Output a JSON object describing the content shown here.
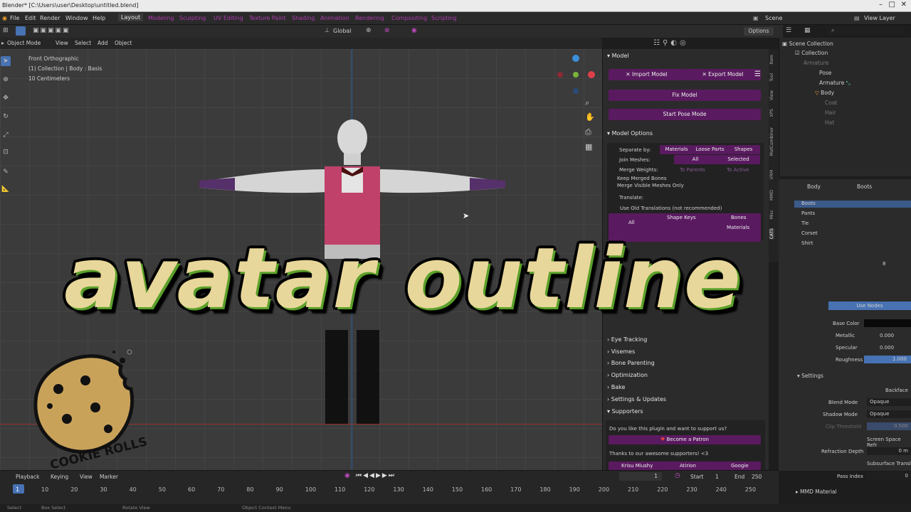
{
  "window_title": "Blender* [C:\\Users\\user\\Desktop\\untitled.blend]",
  "menu": [
    "File",
    "Edit",
    "Render",
    "Window",
    "Help"
  ],
  "workspaces": [
    "Layout",
    "Modeling",
    "Sculpting",
    "UV Editing",
    "Texture Paint",
    "Shading",
    "Animation",
    "Rendering",
    "Compositing",
    "Scripting"
  ],
  "scene_label": "Scene",
  "view_layer_label": "View Layer",
  "header3": {
    "mode": "Object Mode",
    "view": "View",
    "select": "Select",
    "add": "Add",
    "object": "Object",
    "orientation": "Global",
    "options": "Options"
  },
  "viewport_info": [
    "Front Orthographic",
    "(1) Collection | Body : Basis",
    "10 Centimeters"
  ],
  "cats": {
    "model_title": "Model",
    "import_model": "Import Model",
    "export_model": "Export Model",
    "fix_model": "Fix Model",
    "start_pose_mode": "Start Pose Mode",
    "model_options_title": "Model Options",
    "separate_by": "Separate by:",
    "materials": "Materials",
    "loose_parts": "Loose Parts",
    "shapes": "Shapes",
    "join_meshes": "Join Meshes:",
    "all": "All",
    "selected": "Selected",
    "merge_weights": "Merge Weights:",
    "to_parents": "To Parents",
    "to_active": "To Active",
    "keep_merged_bones": "Keep Merged Bones",
    "merge_visible": "Merge Visible Meshes Only",
    "translate": "Translate:",
    "use_old_translations": "Use Old Translations (not recommended)",
    "shape_keys": "Shape Keys",
    "bones": "Bones",
    "all2": "All",
    "materials2": "Materials",
    "sections": [
      "Eye Tracking",
      "Visemes",
      "Bone Parenting",
      "Optimization",
      "Bake",
      "Settings & Updates"
    ],
    "supporters_title": "Supporters",
    "support_question": "Do you like this plugin and want to support us?",
    "become_patron": "Become a Patron",
    "thanks": "Thanks to our awesome supporters! <3",
    "supporters": [
      "Krisu Miushy",
      "Atirion",
      "Googie"
    ]
  },
  "vertical_tabs": [
    "Item",
    "Tool",
    "View",
    "XPS",
    "MatCombiner",
    "VRM",
    "MMD",
    "Misc",
    "CATS"
  ],
  "outliner": {
    "root": "Scene Collection",
    "items": [
      "Collection",
      "Armature",
      "Pose",
      "Armature",
      "Body",
      "Coat",
      "Hair",
      "Hat"
    ]
  },
  "props": {
    "object": "Body",
    "material": "Boots",
    "slots": [
      "Boots",
      "Pants",
      "Tie",
      "Corset",
      "Shirt"
    ],
    "slot_count": "8",
    "use_nodes": "Use Nodes",
    "base_color": "Base Color",
    "metallic": "Metallic",
    "metallic_val": "0.000",
    "specular": "Specular",
    "specular_val": "0.000",
    "roughness": "Roughness",
    "roughness_val": "1.000",
    "settings": "Settings",
    "backface": "Backface",
    "blend_mode": "Blend Mode",
    "blend_val": "Opaque",
    "shadow_mode": "Shadow Mode",
    "shadow_val": "Opaque",
    "clip_threshold": "Clip Threshold",
    "clip_val": "0.500",
    "screen_space": "Screen Space Refr",
    "refraction_depth": "Refraction Depth",
    "refraction_val": "0 m",
    "subsurface": "Subsurface Transl",
    "pass_index": "Pass Index",
    "pass_val": "0",
    "mmd_material": "MMD Material"
  },
  "timeline": {
    "playback": "Playback",
    "keying": "Keying",
    "view": "View",
    "marker": "Marker",
    "current": "1",
    "start_label": "Start",
    "start": "1",
    "end_label": "End",
    "end": "250",
    "ticks": [
      "1",
      "10",
      "20",
      "30",
      "40",
      "50",
      "60",
      "70",
      "80",
      "90",
      "100",
      "110",
      "120",
      "130",
      "140",
      "150",
      "160",
      "170",
      "180",
      "190",
      "200",
      "210",
      "220",
      "230",
      "240",
      "250"
    ]
  },
  "status": {
    "left": "Select",
    "box": "Box Select",
    "rotate": "Rotate View",
    "context": "Object Context Menu"
  },
  "overlay_title": "avatar outline",
  "logo_text": "COOKIE ROLLS",
  "colors": {
    "cats_purple": "#5a1a60",
    "accent_blue": "#4772b3",
    "overlay_text": "#e8d79a",
    "overlay_outline": "#5aa02a"
  }
}
